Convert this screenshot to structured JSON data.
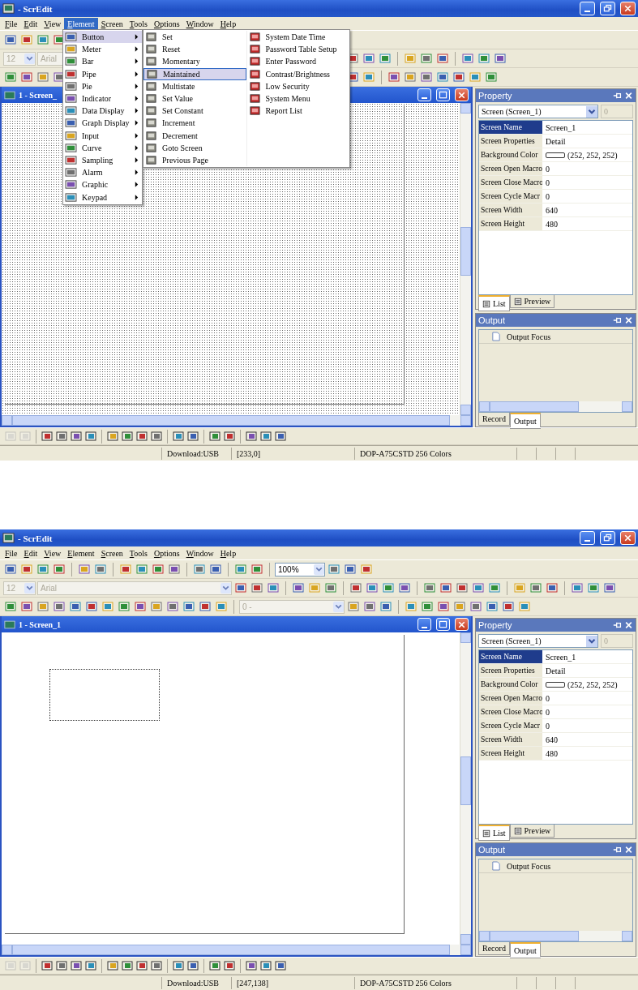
{
  "shots": [
    {
      "window": {
        "title": "- ScrEdit"
      },
      "menu": [
        {
          "label": "File",
          "selected": false
        },
        {
          "label": "Edit",
          "selected": false
        },
        {
          "label": "View",
          "selected": false
        },
        {
          "label": "Element",
          "selected": true
        },
        {
          "label": "Screen",
          "selected": false
        },
        {
          "label": "Tools",
          "selected": false
        },
        {
          "label": "Options",
          "selected": false
        },
        {
          "label": "Window",
          "selected": false
        },
        {
          "label": "Help",
          "selected": false
        }
      ],
      "toolbars": [
        [
          {
            "kind": "icon"
          },
          {
            "kind": "icon"
          },
          {
            "kind": "icon"
          },
          {
            "kind": "icon"
          },
          {
            "kind": "covered"
          }
        ],
        [
          {
            "kind": "combo-small",
            "value": "12",
            "disabled": true
          },
          {
            "kind": "combo-font",
            "value": "Arial",
            "disabled": true
          },
          {
            "kind": "covered"
          },
          {
            "kind": "icon"
          },
          {
            "kind": "icon"
          },
          {
            "kind": "icon"
          },
          {
            "kind": "sep"
          },
          {
            "kind": "icon"
          },
          {
            "kind": "icon"
          },
          {
            "kind": "icon"
          },
          {
            "kind": "sep"
          },
          {
            "kind": "icon"
          },
          {
            "kind": "icon"
          },
          {
            "kind": "icon"
          }
        ],
        [
          {
            "kind": "icon"
          },
          {
            "kind": "icon"
          },
          {
            "kind": "icon"
          },
          {
            "kind": "icon"
          },
          {
            "kind": "covered"
          },
          {
            "kind": "icon"
          },
          {
            "kind": "icon"
          },
          {
            "kind": "sep"
          },
          {
            "kind": "icon"
          },
          {
            "kind": "icon"
          },
          {
            "kind": "icon"
          },
          {
            "kind": "icon"
          },
          {
            "kind": "icon"
          },
          {
            "kind": "icon"
          },
          {
            "kind": "icon"
          }
        ]
      ],
      "element_menu": [
        {
          "label": "Button",
          "selected": true
        },
        {
          "label": "Meter",
          "selected": false
        },
        {
          "label": "Bar",
          "selected": false
        },
        {
          "label": "Pipe",
          "selected": false
        },
        {
          "label": "Pie",
          "selected": false
        },
        {
          "label": "Indicator",
          "selected": false
        },
        {
          "label": "Data Display",
          "selected": false
        },
        {
          "label": "Graph Display",
          "selected": false
        },
        {
          "label": "Input",
          "selected": false
        },
        {
          "label": "Curve",
          "selected": false
        },
        {
          "label": "Sampling",
          "selected": false
        },
        {
          "label": "Alarm",
          "selected": false
        },
        {
          "label": "Graphic",
          "selected": false
        },
        {
          "label": "Keypad",
          "selected": false
        }
      ],
      "button_submenu": [
        [
          {
            "label": "Set",
            "selected": false
          },
          {
            "label": "Reset",
            "selected": false
          },
          {
            "label": "Momentary",
            "selected": false
          },
          {
            "label": "Maintained",
            "selected": true
          },
          {
            "label": "Multistate",
            "selected": false
          },
          {
            "label": "Set Value",
            "selected": false
          },
          {
            "label": "Set Constant",
            "selected": false
          },
          {
            "label": "Increment",
            "selected": false
          },
          {
            "label": "Decrement",
            "selected": false
          },
          {
            "label": "Goto Screen",
            "selected": false
          },
          {
            "label": "Previous Page",
            "selected": false
          }
        ],
        [
          {
            "label": "System Date Time",
            "selected": false
          },
          {
            "label": "Password Table Setup",
            "selected": false
          },
          {
            "label": "Enter Password",
            "selected": false
          },
          {
            "label": "Contrast/Brightness",
            "selected": false
          },
          {
            "label": "Low Security",
            "selected": false
          },
          {
            "label": "System Menu",
            "selected": false
          },
          {
            "label": "Report List",
            "selected": false
          }
        ]
      ],
      "child": {
        "title": "1 - Screen_",
        "grid": true,
        "marquee": false
      },
      "property": {
        "title": "Property",
        "combo": "Screen (Screen_1)",
        "spin": "0",
        "rows": [
          {
            "name": "Screen Name",
            "value": "Screen_1",
            "kind": "text",
            "selected": true
          },
          {
            "name": "Screen Properties",
            "value": "Detail",
            "kind": "text",
            "selected": false
          },
          {
            "name": "Background Color",
            "value": "(252, 252, 252)",
            "kind": "color",
            "selected": false
          },
          {
            "name": "Screen Open Macro",
            "value": "0",
            "kind": "text",
            "selected": false
          },
          {
            "name": "Screen Close Macro",
            "value": "0",
            "kind": "text",
            "selected": false
          },
          {
            "name": "Screen Cycle Macr",
            "value": "0",
            "kind": "text",
            "selected": false
          },
          {
            "name": "Screen Width",
            "value": "640",
            "kind": "text",
            "selected": false
          },
          {
            "name": "Screen Height",
            "value": "480",
            "kind": "text",
            "selected": false
          }
        ],
        "tabs": [
          {
            "label": "List",
            "selected": true
          },
          {
            "label": "Preview",
            "selected": false
          }
        ]
      },
      "output": {
        "title": "Output",
        "header": "Output Focus",
        "tabs": [
          {
            "label": "Record",
            "selected": false
          },
          {
            "label": "Output",
            "selected": true
          }
        ]
      },
      "status_bar": [
        "Download:USB",
        "[233,0]",
        "DOP-A75CSTD 256 Colors"
      ]
    },
    {
      "window": {
        "title": "- ScrEdit"
      },
      "menu": [
        {
          "label": "File",
          "selected": false
        },
        {
          "label": "Edit",
          "selected": false
        },
        {
          "label": "View",
          "selected": false
        },
        {
          "label": "Element",
          "selected": false
        },
        {
          "label": "Screen",
          "selected": false
        },
        {
          "label": "Tools",
          "selected": false
        },
        {
          "label": "Options",
          "selected": false
        },
        {
          "label": "Window",
          "selected": false
        },
        {
          "label": "Help",
          "selected": false
        }
      ],
      "toolbars": [
        [
          {
            "kind": "icon"
          },
          {
            "kind": "icon"
          },
          {
            "kind": "icon"
          },
          {
            "kind": "icon"
          },
          {
            "kind": "sep"
          },
          {
            "kind": "icon"
          },
          {
            "kind": "icon"
          },
          {
            "kind": "sep"
          },
          {
            "kind": "icon"
          },
          {
            "kind": "icon"
          },
          {
            "kind": "icon"
          },
          {
            "kind": "icon"
          },
          {
            "kind": "sep"
          },
          {
            "kind": "icon"
          },
          {
            "kind": "icon"
          },
          {
            "kind": "sep"
          },
          {
            "kind": "icon"
          },
          {
            "kind": "icon"
          },
          {
            "kind": "sep"
          },
          {
            "kind": "combo-zoom",
            "value": "100%",
            "disabled": false
          },
          {
            "kind": "icon"
          },
          {
            "kind": "icon"
          },
          {
            "kind": "icon"
          }
        ],
        [
          {
            "kind": "combo-small",
            "value": "12",
            "disabled": true
          },
          {
            "kind": "combo-font",
            "value": "Arial",
            "disabled": true
          },
          {
            "kind": "icon"
          },
          {
            "kind": "icon"
          },
          {
            "kind": "icon"
          },
          {
            "kind": "sep"
          },
          {
            "kind": "icon"
          },
          {
            "kind": "icon"
          },
          {
            "kind": "icon"
          },
          {
            "kind": "sep"
          },
          {
            "kind": "icon"
          },
          {
            "kind": "icon"
          },
          {
            "kind": "icon"
          },
          {
            "kind": "icon"
          },
          {
            "kind": "sep"
          },
          {
            "kind": "icon"
          },
          {
            "kind": "icon"
          },
          {
            "kind": "icon"
          },
          {
            "kind": "icon"
          },
          {
            "kind": "icon"
          },
          {
            "kind": "sep"
          },
          {
            "kind": "icon"
          },
          {
            "kind": "icon"
          },
          {
            "kind": "icon"
          },
          {
            "kind": "sep"
          },
          {
            "kind": "icon"
          },
          {
            "kind": "icon"
          },
          {
            "kind": "icon"
          }
        ],
        [
          {
            "kind": "icon"
          },
          {
            "kind": "icon"
          },
          {
            "kind": "icon"
          },
          {
            "kind": "icon"
          },
          {
            "kind": "icon"
          },
          {
            "kind": "icon"
          },
          {
            "kind": "icon"
          },
          {
            "kind": "icon"
          },
          {
            "kind": "icon"
          },
          {
            "kind": "icon"
          },
          {
            "kind": "icon"
          },
          {
            "kind": "icon"
          },
          {
            "kind": "icon"
          },
          {
            "kind": "icon"
          },
          {
            "kind": "sep"
          },
          {
            "kind": "combo-value",
            "value": "0 -",
            "disabled": true
          },
          {
            "kind": "icon"
          },
          {
            "kind": "icon"
          },
          {
            "kind": "icon"
          },
          {
            "kind": "sep"
          },
          {
            "kind": "icon"
          },
          {
            "kind": "icon"
          },
          {
            "kind": "icon"
          },
          {
            "kind": "icon"
          },
          {
            "kind": "icon"
          },
          {
            "kind": "icon"
          },
          {
            "kind": "icon"
          },
          {
            "kind": "icon"
          }
        ]
      ],
      "child": {
        "title": "1 - Screen_1",
        "grid": false,
        "marquee": true
      },
      "property": {
        "title": "Property",
        "combo": "Screen (Screen_1)",
        "spin": "0",
        "rows": [
          {
            "name": "Screen Name",
            "value": "Screen_1",
            "kind": "text",
            "selected": true
          },
          {
            "name": "Screen Properties",
            "value": "Detail",
            "kind": "text",
            "selected": false
          },
          {
            "name": "Background Color",
            "value": "(252, 252, 252)",
            "kind": "color",
            "selected": false
          },
          {
            "name": "Screen Open Macro",
            "value": "0",
            "kind": "text",
            "selected": false
          },
          {
            "name": "Screen Close Macro",
            "value": "0",
            "kind": "text",
            "selected": false
          },
          {
            "name": "Screen Cycle Macr",
            "value": "0",
            "kind": "text",
            "selected": false
          },
          {
            "name": "Screen Width",
            "value": "640",
            "kind": "text",
            "selected": false
          },
          {
            "name": "Screen Height",
            "value": "480",
            "kind": "text",
            "selected": false
          }
        ],
        "tabs": [
          {
            "label": "List",
            "selected": true
          },
          {
            "label": "Preview",
            "selected": false
          }
        ]
      },
      "output": {
        "title": "Output",
        "header": "Output Focus",
        "tabs": [
          {
            "label": "Record",
            "selected": false
          },
          {
            "label": "Output",
            "selected": true
          }
        ]
      },
      "status_bar": [
        "Download:USB",
        "[247,138]",
        "DOP-A75CSTD 256 Colors"
      ]
    }
  ]
}
